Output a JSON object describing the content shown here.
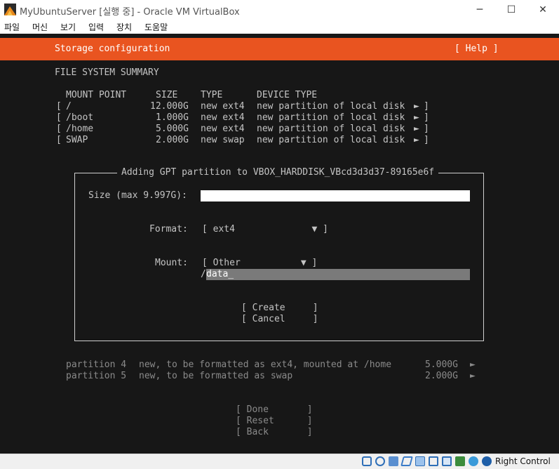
{
  "window": {
    "title": "MyUbuntuServer [실행 중] - Oracle VM VirtualBox",
    "minimize_glyph": "─",
    "maximize_glyph": "☐",
    "close_glyph": "✕"
  },
  "menubar": {
    "items": [
      "파일",
      "머신",
      "보기",
      "입력",
      "장치",
      "도움말"
    ]
  },
  "installer": {
    "header_title": "Storage configuration",
    "help_label": "[ Help ]",
    "summary_heading": "FILE SYSTEM SUMMARY",
    "columns": {
      "mount": "MOUNT POINT",
      "size": "SIZE",
      "type": "TYPE",
      "device": "DEVICE TYPE"
    },
    "rows": [
      {
        "open": "[",
        "mount": "/",
        "size": "12.000G",
        "type": "new ext4",
        "device": "new partition of local disk",
        "arrow": "►",
        "close": "]"
      },
      {
        "open": "[",
        "mount": "/boot",
        "size": "1.000G",
        "type": "new ext4",
        "device": "new partition of local disk",
        "arrow": "►",
        "close": "]"
      },
      {
        "open": "[",
        "mount": "/home",
        "size": "5.000G",
        "type": "new ext4",
        "device": "new partition of local disk",
        "arrow": "►",
        "close": "]"
      },
      {
        "open": "[",
        "mount": "SWAP",
        "size": "2.000G",
        "type": "new swap",
        "device": "new partition of local disk",
        "arrow": "►",
        "close": "]"
      }
    ],
    "dialog": {
      "title": "Adding GPT partition to VBOX_HARDDISK_VBcd3d3d37-89165e6f",
      "size_label": "Size (max 9.997G):",
      "size_value": "",
      "format_label": "Format:",
      "format_value": "[ ext4              ▼ ]",
      "mount_label": "Mount:",
      "mount_value": "[ Other           ▼ ]",
      "mount_prefix": "/",
      "mount_path": "data_",
      "create_label": "[ Create     ]",
      "cancel_label": "[ Cancel     ]"
    },
    "partitions": [
      {
        "name": "partition 4",
        "desc": "new, to be formatted as ext4, mounted at /home",
        "size": "5.000G",
        "arrow": "►"
      },
      {
        "name": "partition 5",
        "desc": "new, to be formatted as swap",
        "size": "2.000G",
        "arrow": "►"
      }
    ],
    "buttons": {
      "done": "[ Done       ]",
      "reset": "[ Reset      ]",
      "back": "[ Back       ]"
    }
  },
  "statusbar": {
    "host_key": "Right Control",
    "icons": [
      "hard-disk-icon",
      "optical-drive-icon",
      "audio-icon",
      "network-icon",
      "shared-folder-icon",
      "display-icon",
      "video-capture-icon",
      "cpu-icon",
      "mouse-integration-icon",
      "keyboard-capture-icon"
    ]
  },
  "colors": {
    "accent": "#e95420",
    "terminal_bg": "#171717",
    "terminal_fg": "#c4c4c4"
  }
}
